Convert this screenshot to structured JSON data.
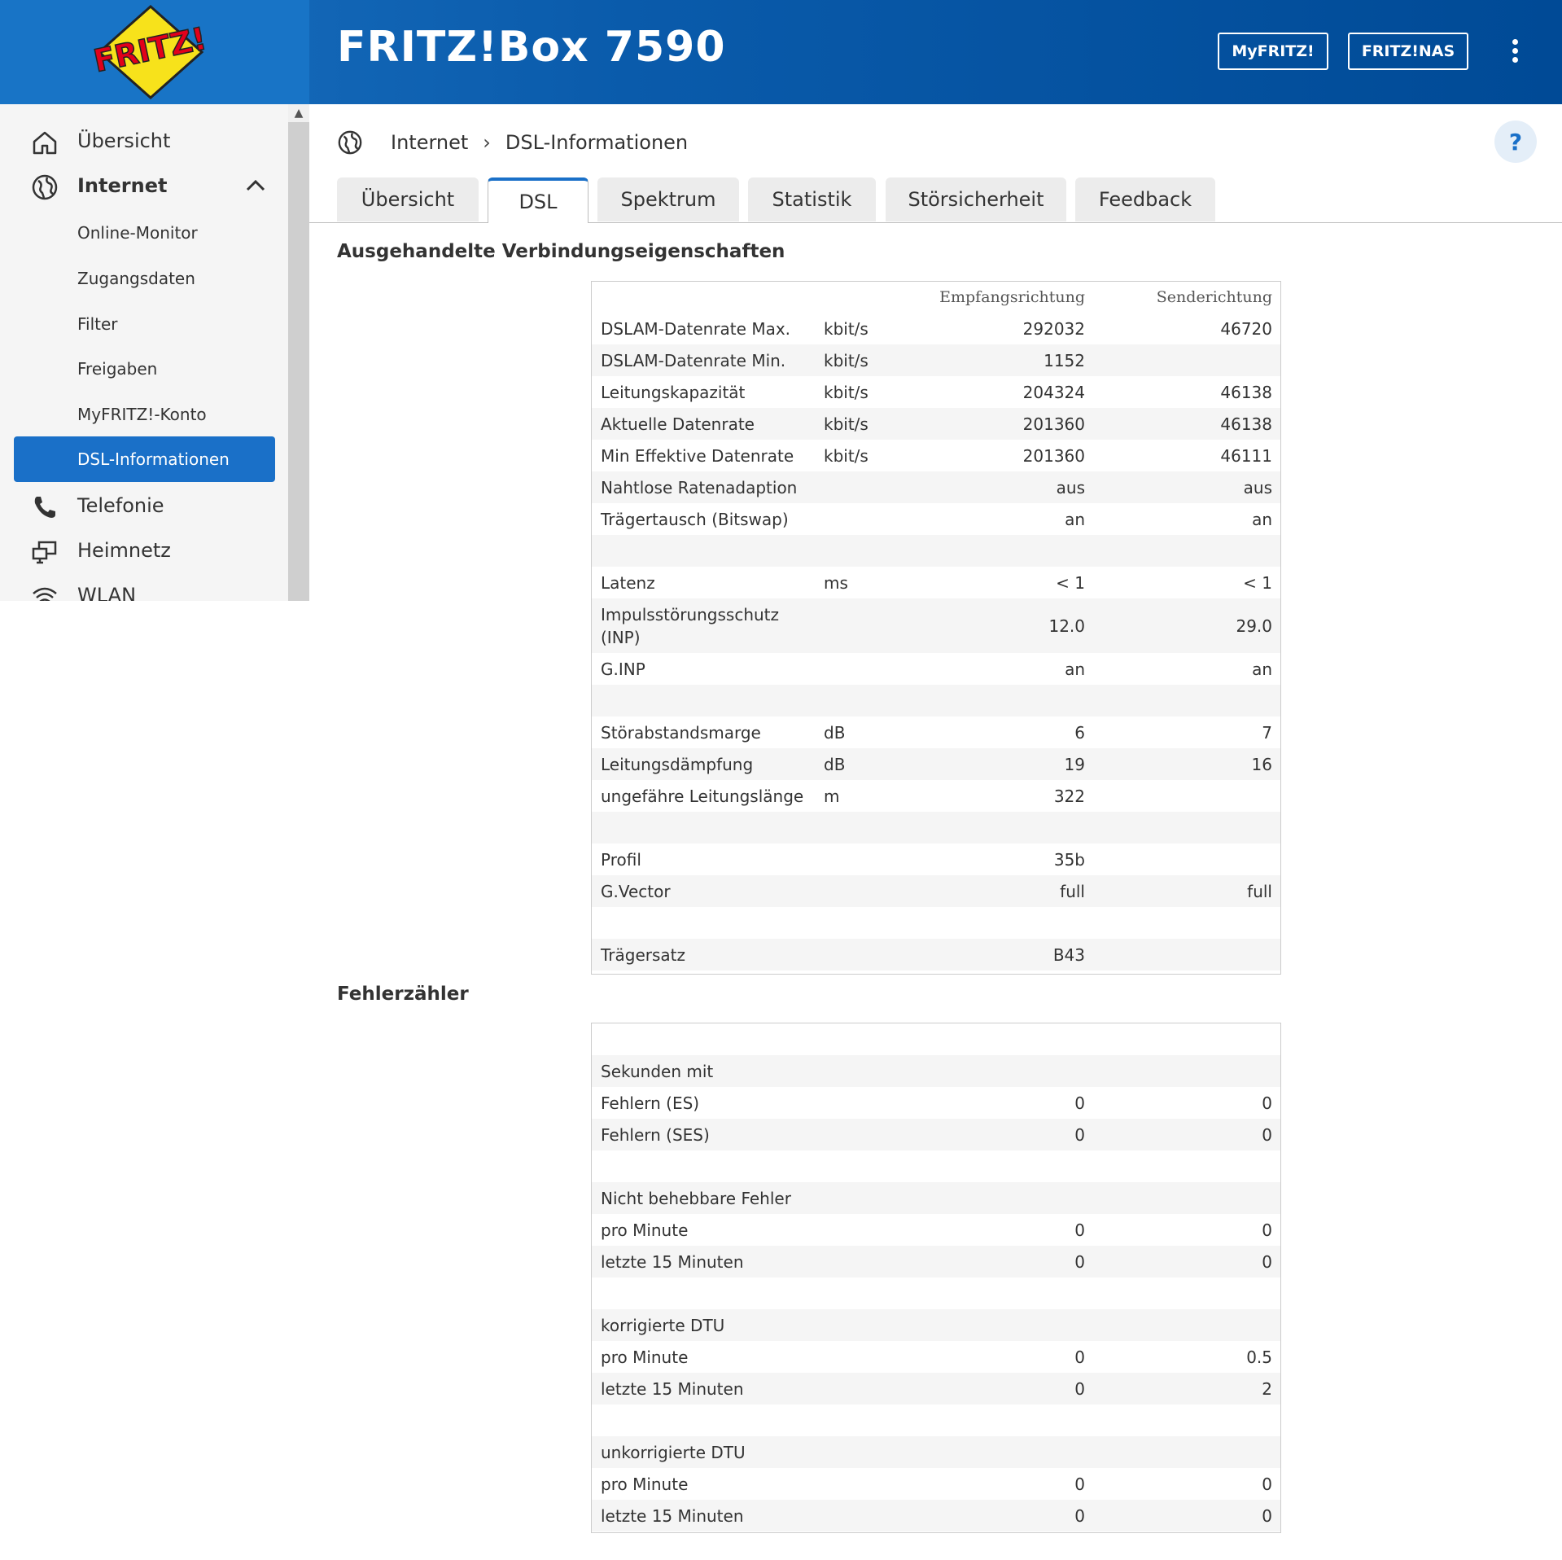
{
  "colors": {
    "header": "#0a5bab",
    "accent": "#1a70c8",
    "active_nav": "#1a70c8"
  },
  "header": {
    "logo_text": "FRITZ!",
    "title": "FRITZ!Box 7590",
    "myfritz_label": "MyFRITZ!",
    "fritznas_label": "FRITZ!NAS",
    "menu_icon": "kebab-menu-icon"
  },
  "sidebar": {
    "main": [
      {
        "label": "Übersicht",
        "icon": "home-icon"
      },
      {
        "label": "Internet",
        "icon": "globe-icon"
      },
      {
        "label": "Telefonie",
        "icon": "phone-icon"
      },
      {
        "label": "Heimnetz",
        "icon": "network-icon"
      },
      {
        "label": "WLAN",
        "icon": "wifi-icon"
      }
    ],
    "internet_sub": [
      {
        "label": "Online-Monitor"
      },
      {
        "label": "Zugangsdaten"
      },
      {
        "label": "Filter"
      },
      {
        "label": "Freigaben"
      },
      {
        "label": "MyFRITZ!-Konto"
      },
      {
        "label": "DSL-Informationen"
      }
    ]
  },
  "breadcrumb": {
    "root": "Internet",
    "current": "DSL-Informationen"
  },
  "help_label": "?",
  "tabs": [
    {
      "label": "Übersicht"
    },
    {
      "label": "DSL"
    },
    {
      "label": "Spektrum"
    },
    {
      "label": "Statistik"
    },
    {
      "label": "Störsicherheit"
    },
    {
      "label": "Feedback"
    }
  ],
  "connection": {
    "title": "Ausgehandelte Verbindungseigenschaften",
    "col_rx": "Empfangsrichtung",
    "col_tx": "Senderichtung",
    "rows": [
      {
        "label": "DSLAM-Datenrate Max.",
        "unit": "kbit/s",
        "rx": "292032",
        "tx": "46720"
      },
      {
        "label": "DSLAM-Datenrate Min.",
        "unit": "kbit/s",
        "rx": "1152",
        "tx": ""
      },
      {
        "label": "Leitungskapazität",
        "unit": "kbit/s",
        "rx": "204324",
        "tx": "46138"
      },
      {
        "label": "Aktuelle Datenrate",
        "unit": "kbit/s",
        "rx": "201360",
        "tx": "46138"
      },
      {
        "label": "Min Effektive Datenrate",
        "unit": "kbit/s",
        "rx": "201360",
        "tx": "46111"
      },
      {
        "label": "Nahtlose Ratenadaption",
        "unit": "",
        "rx": "aus",
        "tx": "aus"
      },
      {
        "label": "Trägertausch (Bitswap)",
        "unit": "",
        "rx": "an",
        "tx": "an"
      },
      {
        "label": "",
        "unit": "",
        "rx": "",
        "tx": ""
      },
      {
        "label": "Latenz",
        "unit": "ms",
        "rx": "< 1",
        "tx": "< 1"
      },
      {
        "label": "Impulsstörungsschutz (INP)",
        "unit": "",
        "rx": "12.0",
        "tx": "29.0"
      },
      {
        "label": "G.INP",
        "unit": "",
        "rx": "an",
        "tx": "an"
      },
      {
        "label": "",
        "unit": "",
        "rx": "",
        "tx": ""
      },
      {
        "label": "Störabstandsmarge",
        "unit": "dB",
        "rx": "6",
        "tx": "7"
      },
      {
        "label": "Leitungsdämpfung",
        "unit": "dB",
        "rx": "19",
        "tx": "16"
      },
      {
        "label": "ungefähre Leitungslänge",
        "unit": "m",
        "rx": "322",
        "tx": ""
      },
      {
        "label": "",
        "unit": "",
        "rx": "",
        "tx": ""
      },
      {
        "label": "Profil",
        "unit": "",
        "rx": "35b",
        "tx": ""
      },
      {
        "label": "G.Vector",
        "unit": "",
        "rx": "full",
        "tx": "full"
      },
      {
        "label": "",
        "unit": "",
        "rx": "",
        "tx": ""
      },
      {
        "label": "Trägersatz",
        "unit": "",
        "rx": "B43",
        "tx": ""
      }
    ]
  },
  "errors": {
    "title": "Fehlerzähler",
    "rows": [
      {
        "label": "",
        "rx": "",
        "tx": ""
      },
      {
        "label": "Sekunden mit",
        "rx": "",
        "tx": ""
      },
      {
        "label": "Fehlern (ES)",
        "rx": "0",
        "tx": "0"
      },
      {
        "label": "Fehlern (SES)",
        "rx": "0",
        "tx": "0"
      },
      {
        "label": "",
        "rx": "",
        "tx": ""
      },
      {
        "label": "Nicht behebbare Fehler",
        "rx": "",
        "tx": ""
      },
      {
        "label": "pro Minute",
        "rx": "0",
        "tx": "0"
      },
      {
        "label": "letzte 15 Minuten",
        "rx": "0",
        "tx": "0"
      },
      {
        "label": "",
        "rx": "",
        "tx": ""
      },
      {
        "label": "korrigierte DTU",
        "rx": "",
        "tx": ""
      },
      {
        "label": "pro Minute",
        "rx": "0",
        "tx": "0.5"
      },
      {
        "label": "letzte 15 Minuten",
        "rx": "0",
        "tx": "2"
      },
      {
        "label": "",
        "rx": "",
        "tx": ""
      },
      {
        "label": "unkorrigierte DTU",
        "rx": "",
        "tx": ""
      },
      {
        "label": "pro Minute",
        "rx": "0",
        "tx": "0"
      },
      {
        "label": "letzte 15 Minuten",
        "rx": "0",
        "tx": "0"
      }
    ]
  }
}
